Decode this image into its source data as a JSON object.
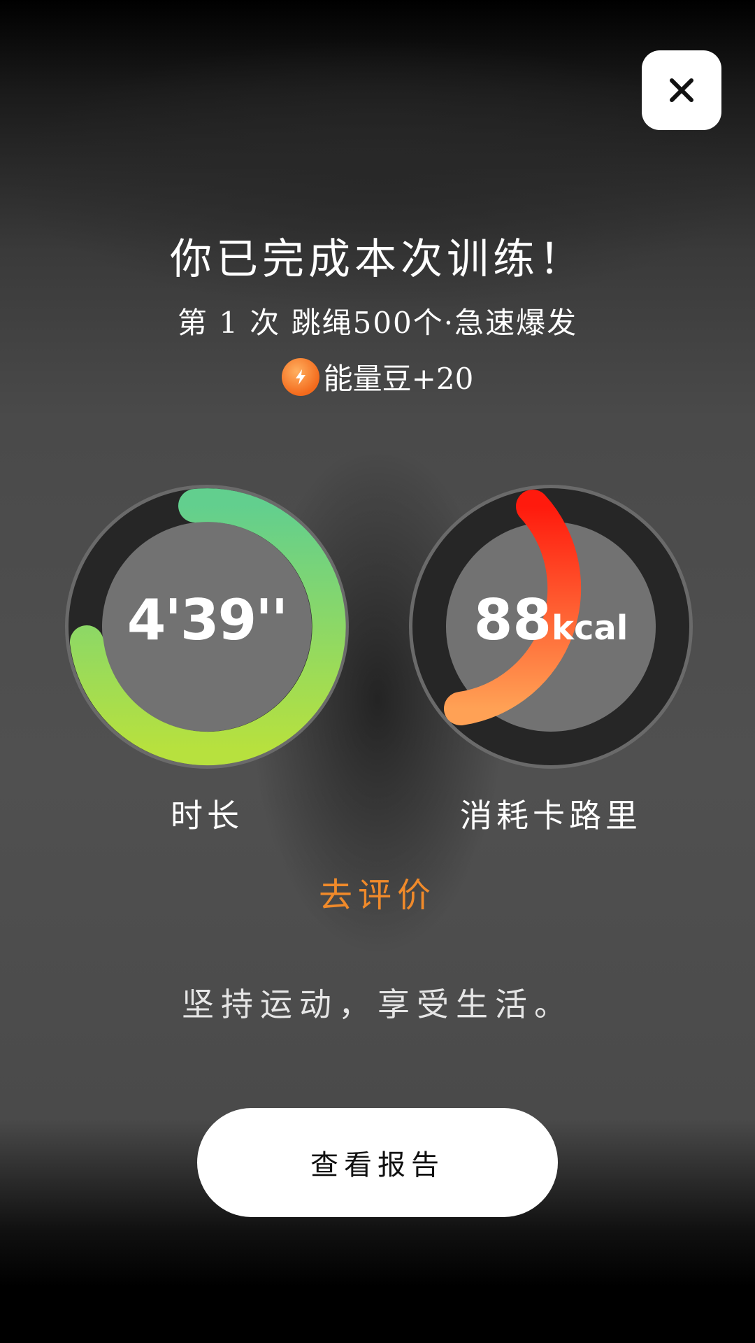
{
  "header": {
    "close_icon": "close-icon"
  },
  "summary": {
    "title": "你已完成本次训练！",
    "subtitle": "第 1 次 跳绳500个·急速爆发",
    "reward_icon": "energy-bean-icon",
    "reward_text": "能量豆+20"
  },
  "stats": {
    "duration": {
      "value": "4'39''",
      "label": "时长",
      "colors": [
        "#b7e13e",
        "#62cf8e"
      ]
    },
    "calories": {
      "number": "88",
      "unit": "kcal",
      "label": "消耗卡路里",
      "colors": [
        "#ffa155",
        "#ff1a0d"
      ]
    }
  },
  "actions": {
    "rate_label": "去评价",
    "motto": "坚持运动，享受生活。",
    "report_button": "查看报告"
  },
  "colors": {
    "accent_orange": "#f08a2a",
    "button_bg": "#ffffff"
  }
}
